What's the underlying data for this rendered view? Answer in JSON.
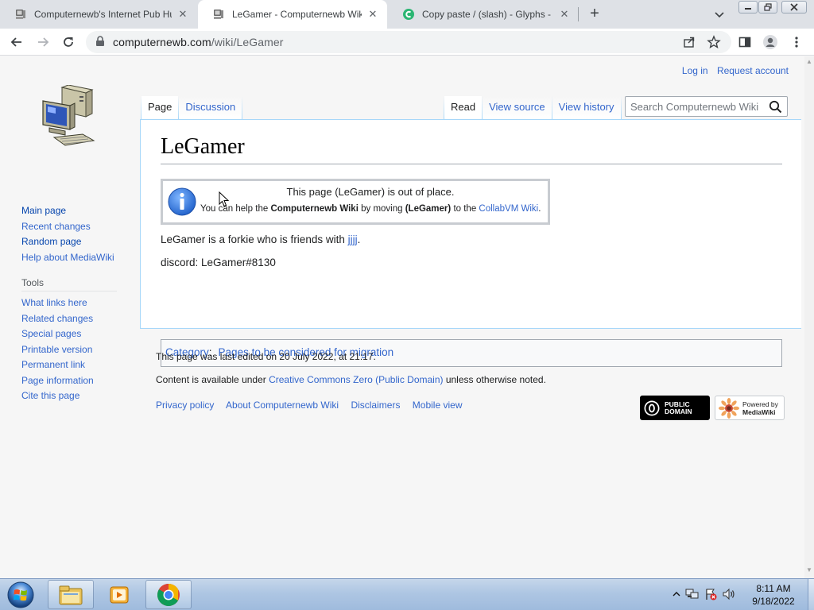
{
  "browser": {
    "tabs": [
      {
        "title": "Computernewb's Internet Pub Hub",
        "close": "✕"
      },
      {
        "title": "LeGamer - Computernewb Wiki",
        "close": "✕"
      },
      {
        "title": "Copy paste / (slash) - Glyphs - GlyphsCopy",
        "close": "✕"
      }
    ],
    "new_tab": "+",
    "url_host": "computernewb.com",
    "url_path": "/wiki/LeGamer"
  },
  "wiki": {
    "personal": {
      "login": "Log in",
      "request": "Request account"
    },
    "tabs_left": {
      "page": "Page",
      "discussion": "Discussion"
    },
    "tabs_right": {
      "read": "Read",
      "view_source": "View source",
      "view_history": "View history"
    },
    "search_placeholder": "Search Computernewb Wiki",
    "title": "LeGamer",
    "notice": {
      "line1": "This page (LeGamer) is out of place.",
      "line2_a": "You can help the ",
      "line2_b": "Computernewb Wiki",
      "line2_c": " by moving ",
      "line2_d": "(LeGamer)",
      "line2_e": " to the ",
      "line2_link": "CollabVM Wiki",
      "line2_f": "."
    },
    "body": {
      "p1_text": "LeGamer is a forkie who is friends with ",
      "p1_link": "jjjj",
      "p1_end": ".",
      "p2": "discord: LeGamer#8130"
    },
    "category": {
      "label": "Category",
      "colon": ":",
      "item": "Pages to be considered for migration"
    },
    "sidebar": {
      "navigation": [
        "Main page",
        "Recent changes",
        "Random page",
        "Help about MediaWiki"
      ],
      "tools_heading": "Tools",
      "tools": [
        "What links here",
        "Related changes",
        "Special pages",
        "Printable version",
        "Permanent link",
        "Page information",
        "Cite this page"
      ]
    },
    "footer": {
      "last_edited": "This page was last edited on 20 July 2022, at 21:17.",
      "license_a": "Content is available under ",
      "license_link": "Creative Commons Zero (Public Domain)",
      "license_b": " unless otherwise noted.",
      "links": [
        "Privacy policy",
        "About Computernewb Wiki",
        "Disclaimers",
        "Mobile view"
      ],
      "badge_pd_l1": "PUBLIC",
      "badge_pd_l2": "DOMAIN",
      "badge_mw_l1": "Powered by",
      "badge_mw_l2": "MediaWiki"
    }
  },
  "taskbar": {
    "time": "8:11 AM",
    "date": "9/18/2022"
  },
  "colors": {
    "link": "#3366cc",
    "tab_border": "#a7d7f9",
    "taskbar": "#aec6e3"
  }
}
